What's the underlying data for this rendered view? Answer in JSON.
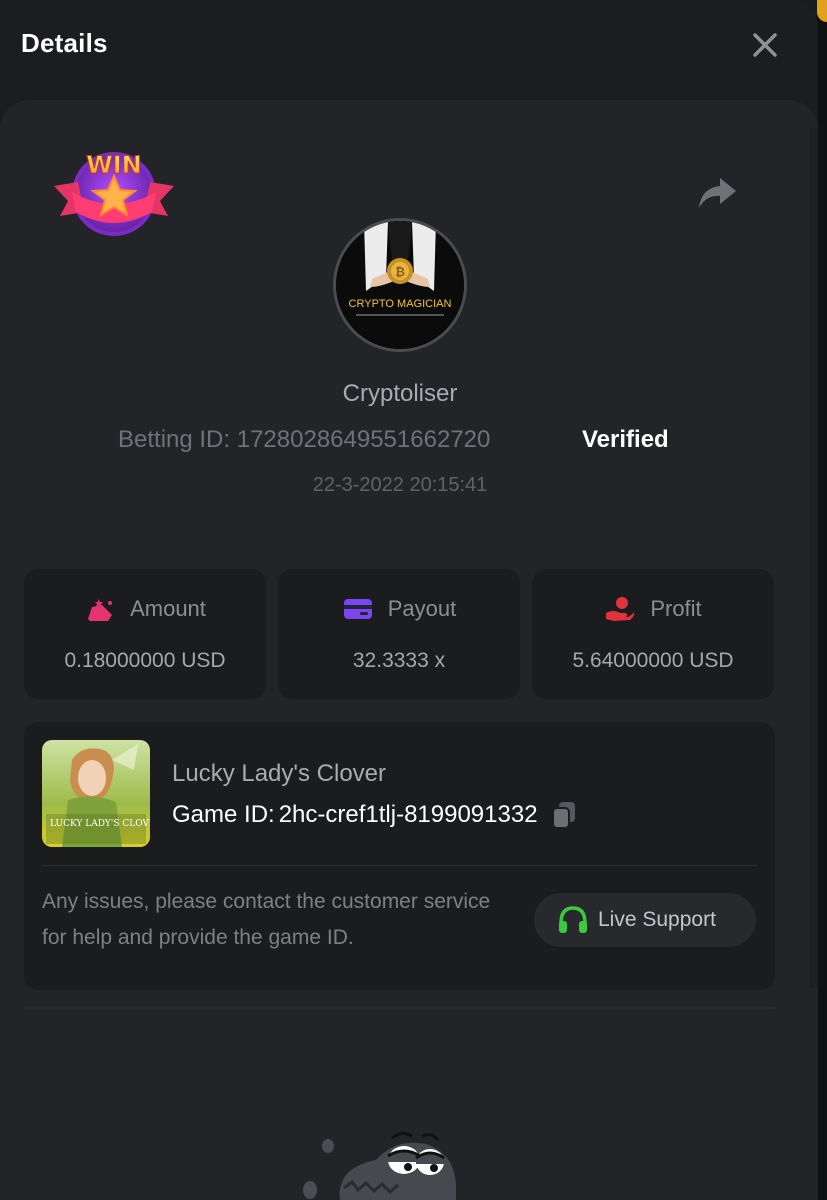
{
  "header": {
    "title": "Details"
  },
  "bet": {
    "username": "Cryptoliser",
    "avatar_caption": "CRYPTO MAGICIAN",
    "betting_id_label": "Betting ID:",
    "betting_id": "1728028649551662720",
    "verified": "Verified",
    "datetime": "22-3-2022 20:15:41",
    "win_badge_text": "WIN"
  },
  "stats": [
    {
      "label": "Amount",
      "value": "0.18000000 USD",
      "icon": "amount-icon"
    },
    {
      "label": "Payout",
      "value": "32.3333 x",
      "icon": "payout-card-icon"
    },
    {
      "label": "Profit",
      "value": "5.64000000 USD",
      "icon": "profit-hand-icon"
    }
  ],
  "game": {
    "name": "Lucky Lady's Clover",
    "id_label": "Game ID:",
    "id": "2hc-cref1tlj-8199091332",
    "thumb_text": "LUCKY LADY'S CLOVER",
    "support_text": "Any issues, please contact the customer service for help and provide the game ID.",
    "live_support_label": "Live Support"
  },
  "colors": {
    "background": "#1c1d1f",
    "card": "#232427",
    "amount_icon": "#e5336f",
    "payout_icon": "#7b45f0",
    "profit_icon": "#e2323b",
    "support_icon": "#3cc93f"
  }
}
